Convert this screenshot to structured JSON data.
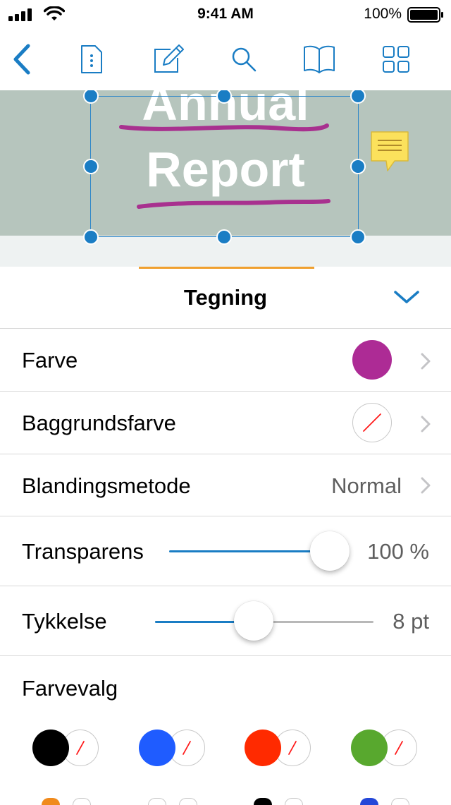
{
  "status_bar": {
    "time": "9:41 AM",
    "battery": "100%"
  },
  "toolbar": {
    "icons": [
      "back-chevron-icon",
      "document-info-icon",
      "annotate-pencil-icon",
      "search-icon",
      "book-icon",
      "grid-view-icon"
    ],
    "accent": "#1a7dc4"
  },
  "document": {
    "title_line1": "Annual",
    "title_line2": "Report",
    "banner_color": "#b6c5bd",
    "ink_color": "#a8318f"
  },
  "panel": {
    "title": "Tegning",
    "tab_accent": "#f0a030",
    "rows": {
      "color": {
        "label": "Farve",
        "swatch": "#ad2b95"
      },
      "background": {
        "label": "Baggrundsfarve"
      },
      "blend": {
        "label": "Blandingsmetode",
        "value": "Normal"
      },
      "opacity": {
        "label": "Transparens",
        "value": "100 %",
        "level": 1.0
      },
      "thickness": {
        "label": "Tykkelse",
        "value": "8 pt",
        "level": 0.4
      }
    },
    "presets": {
      "label": "Farvevalg",
      "colors": [
        "#000000",
        "#1f5cff",
        "#ff2a00",
        "#58a82e"
      ]
    }
  }
}
